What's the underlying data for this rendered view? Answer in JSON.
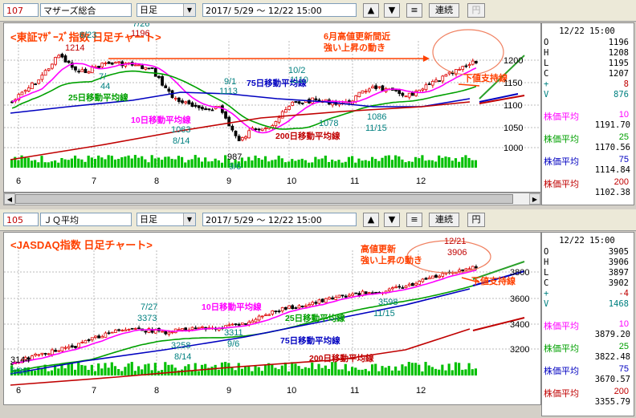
{
  "top": {
    "toolbar": {
      "code": "107",
      "name": "マザーズ総合",
      "period": "日足",
      "date_range": "2017/ 5/29 〜 12/22 15:00",
      "up_btn": "▲",
      "down_btn": "▼",
      "menu_btn": "≡",
      "continuous_btn": "連続",
      "yen_btn": "円"
    },
    "title": "<東証ﾏｻﾞｰｽﾞ指数  日足チャート>",
    "annotation": "6月高値更新間近",
    "annotation2": "強い上昇の動き",
    "support_label": "下値支持線",
    "ma25_label": "25日移動平均線",
    "ma10_label": "10日移動平均線",
    "ma75_label": "75日移動平均線",
    "ma200_label": "200日移動平均線",
    "price_labels": [
      {
        "text": "6/23",
        "c": "#008080"
      },
      {
        "text": "1214",
        "c": "#c00000"
      },
      {
        "text": "7/26",
        "c": "#008080"
      },
      {
        "text": "1196",
        "c": "#c00000"
      },
      {
        "text": "7/",
        "c": "#008080"
      },
      {
        "text": "44",
        "c": "#008080"
      },
      {
        "text": "1063",
        "c": "#008080"
      },
      {
        "text": "8/14",
        "c": "#008080"
      },
      {
        "text": "987",
        "c": "#000"
      },
      {
        "text": "9/6",
        "c": "#008080"
      },
      {
        "text": "9/1",
        "c": "#008080"
      },
      {
        "text": "1113",
        "c": "#008080"
      },
      {
        "text": "10/2",
        "c": "#008080"
      },
      {
        "text": "1110",
        "c": "#008080"
      },
      {
        "text": "1078",
        "c": "#008080"
      },
      {
        "text": "1086",
        "c": "#008080"
      },
      {
        "text": "11/15",
        "c": "#008080"
      }
    ],
    "yticks": [
      "1200",
      "1150",
      "1100",
      "1050",
      "1000"
    ],
    "xticks": [
      "6",
      "7",
      "8",
      "9",
      "10",
      "11",
      "12"
    ],
    "info": {
      "datetime": "12/22 15:00",
      "rows": [
        {
          "k": "O",
          "v": "1196"
        },
        {
          "k": "H",
          "v": "1208"
        },
        {
          "k": "L",
          "v": "1195"
        },
        {
          "k": "C",
          "v": "1207"
        },
        {
          "k": "+",
          "v": "8"
        },
        {
          "k": "V",
          "v": "876"
        }
      ],
      "ma": [
        {
          "label": "株価平均",
          "period": "10",
          "value": "1191.70",
          "color": "#ff00ff"
        },
        {
          "label": "株価平均",
          "period": "25",
          "value": "1170.56",
          "color": "#00a000"
        },
        {
          "label": "株価平均",
          "period": "75",
          "value": "1114.84",
          "color": "#0000c0"
        },
        {
          "label": "株価平均",
          "period": "200",
          "value": "1102.38",
          "color": "#c00000"
        }
      ]
    }
  },
  "bottom": {
    "toolbar": {
      "code": "105",
      "name": "ＪＱ平均",
      "period": "日足",
      "date_range": "2017/ 5/29 〜 12/22 15:00",
      "up_btn": "▲",
      "down_btn": "▼",
      "menu_btn": "≡",
      "continuous_btn": "連続",
      "yen_btn": "円"
    },
    "title": "<JASDAQ指数  日足チャート>",
    "annotation": "高値更新",
    "annotation2": "強い上昇の動き",
    "support_label": "下値支持線",
    "ma25_label": "25日移動平均線",
    "ma10_label": "10日移動平均線",
    "ma75_label": "75日移動平均線",
    "ma200_label": "200日移動平均線",
    "price_labels": [
      {
        "text": "12/21",
        "c": "#c00000"
      },
      {
        "text": "3906",
        "c": "#c00000"
      },
      {
        "text": "7/27",
        "c": "#008080"
      },
      {
        "text": "3373",
        "c": "#008080"
      },
      {
        "text": "3258",
        "c": "#008080"
      },
      {
        "text": "8/14",
        "c": "#008080"
      },
      {
        "text": "3311",
        "c": "#008080"
      },
      {
        "text": "9/6",
        "c": "#008080"
      },
      {
        "text": "3598",
        "c": "#008080"
      },
      {
        "text": "11/15",
        "c": "#008080"
      },
      {
        "text": "3144",
        "c": "#000"
      },
      {
        "text": "5/30",
        "c": "#008080"
      }
    ],
    "yticks": [
      "3800",
      "3600",
      "3400",
      "3200"
    ],
    "xticks": [
      "6",
      "7",
      "8",
      "9",
      "10",
      "11",
      "12"
    ],
    "info": {
      "datetime": "12/22 15:00",
      "rows": [
        {
          "k": "O",
          "v": "3905"
        },
        {
          "k": "H",
          "v": "3906"
        },
        {
          "k": "L",
          "v": "3897"
        },
        {
          "k": "C",
          "v": "3902"
        },
        {
          "k": "+",
          "v": "-4"
        },
        {
          "k": "V",
          "v": "1468"
        }
      ],
      "ma": [
        {
          "label": "株価平均",
          "period": "10",
          "value": "3879.20",
          "color": "#ff00ff"
        },
        {
          "label": "株価平均",
          "period": "25",
          "value": "3822.48",
          "color": "#00a000"
        },
        {
          "label": "株価平均",
          "period": "75",
          "value": "3670.57",
          "color": "#0000c0"
        },
        {
          "label": "株価平均",
          "period": "200",
          "value": "3355.79",
          "color": "#c00000"
        }
      ]
    }
  },
  "colors": {
    "ma10": "#ff00ff",
    "ma25": "#00a000",
    "ma75": "#0000c0",
    "ma200": "#c00000",
    "annot": "#ff4000",
    "volume": "#00c000"
  }
}
